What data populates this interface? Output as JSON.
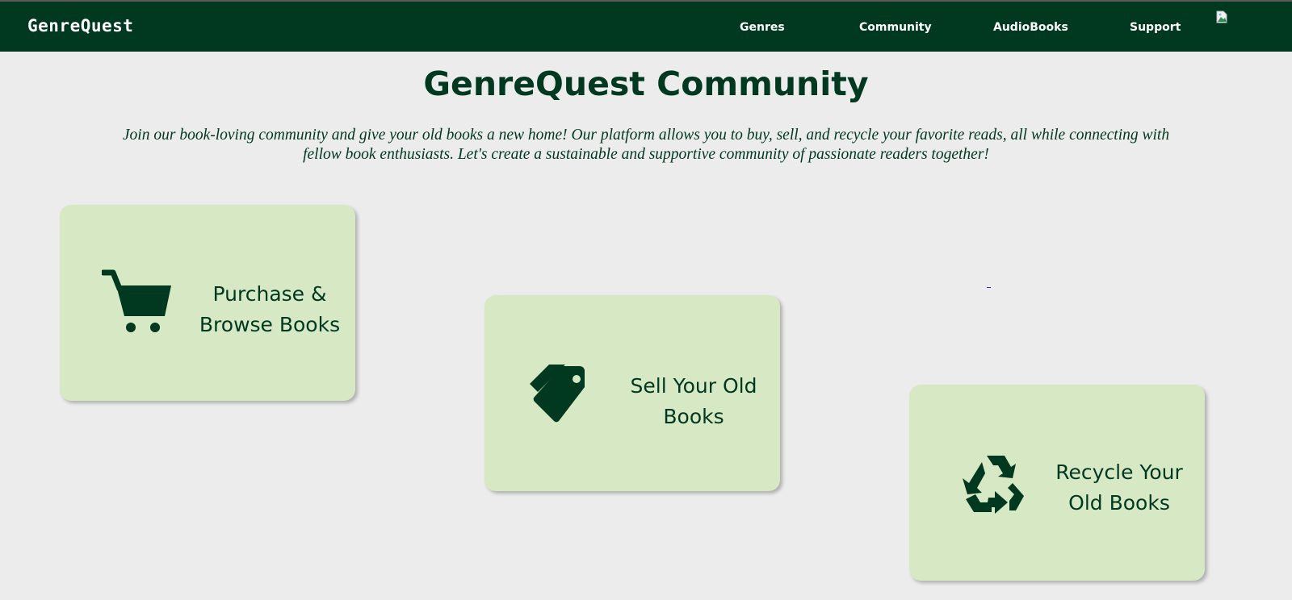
{
  "brand": {
    "name": "GenreQuest"
  },
  "nav": {
    "genres": "Genres",
    "community": "Community",
    "audiobooks": "AudioBooks",
    "support": "Support"
  },
  "header_image": {
    "icon": "broken-image-icon"
  },
  "page": {
    "title": "GenreQuest Community",
    "intro": "Join our book-loving community and give your old books a new home! Our platform allows you to buy, sell, and recycle your favorite reads, all while connecting with fellow book enthusiasts. Let's create a sustainable and supportive community of passionate readers together!"
  },
  "cards": [
    {
      "label": "Purchase & Browse Books",
      "icon": "shopping-cart-icon"
    },
    {
      "label": "Sell Your Old Books",
      "icon": "price-tags-icon"
    },
    {
      "label": "Recycle Your Old Books",
      "icon": "recycle-icon"
    }
  ],
  "colors": {
    "navbar_bg": "#003820",
    "page_bg": "#ececec",
    "card_bg": "#d6e8c4",
    "text_primary": "#003820",
    "nav_text": "#ffffff"
  }
}
